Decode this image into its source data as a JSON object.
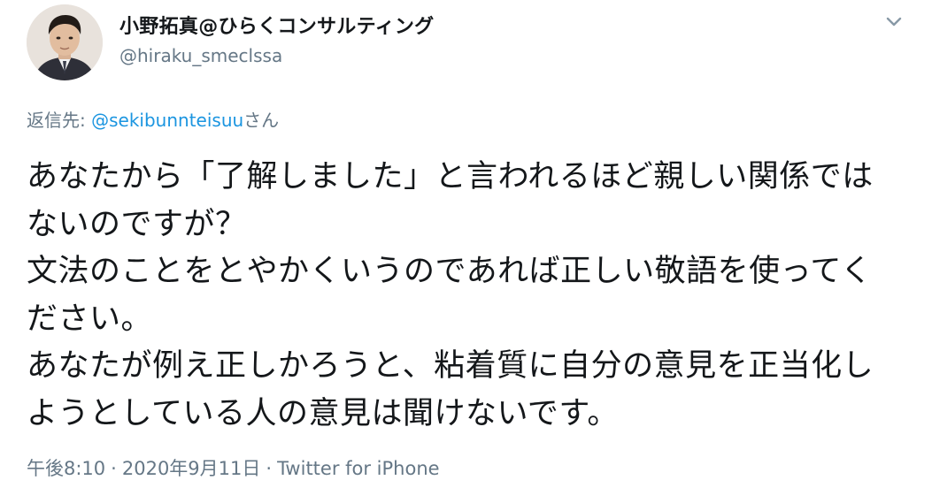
{
  "tweet": {
    "author": {
      "display_name": "小野拓真@ひらくコンサルティング",
      "handle": "@hiraku_smeclssa",
      "avatar": "profile-photo"
    },
    "menu_icon": "chevron-down-icon",
    "reply": {
      "prefix": "返信先: ",
      "mention": "@sekibunnteisuu",
      "suffix": "さん"
    },
    "text": "あなたから「了解しました」と言われるほど親しい関係ではないのですが？\n文法のことをとやかくいうのであれば正しい敬語を使ってください。\nあなたが例え正しかろうと、粘着質に自分の意見を正当化しようとしている人の意見は聞けないです。",
    "timestamp": {
      "time": "午後8:10",
      "separator": "·",
      "date": "2020年9月11日",
      "source": "Twitter for iPhone"
    }
  },
  "colors": {
    "text_primary": "#14171a",
    "text_secondary": "#657786",
    "link": "#1b95e0",
    "background": "#ffffff"
  }
}
